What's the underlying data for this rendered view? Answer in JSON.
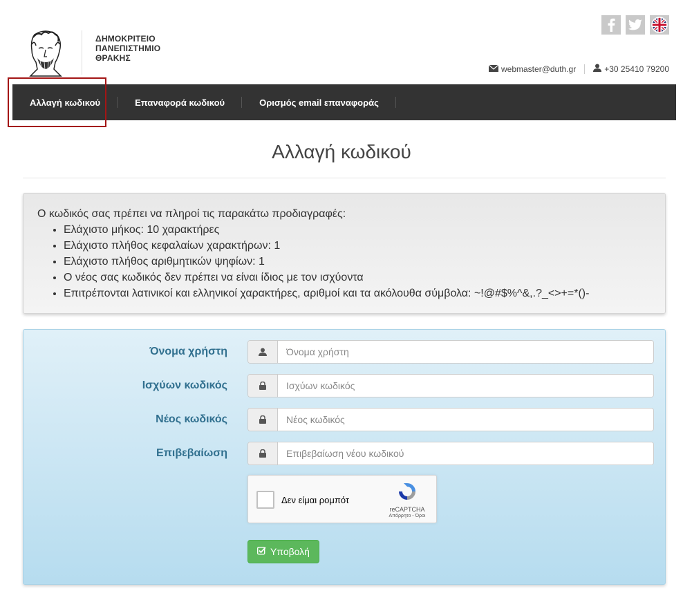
{
  "header": {
    "university_name": [
      "ΔΗΜΟΚΡΙΤΕΙΟ",
      "ΠΑΝΕΠΙΣΤΗΜΙΟ",
      "ΘΡΑΚΗΣ"
    ],
    "social_icons": [
      "facebook-icon",
      "twitter-icon",
      "english-language-icon"
    ],
    "email": "webmaster@duth.gr",
    "phone": "+30 25410 79200"
  },
  "nav": {
    "tabs": [
      {
        "label": "Αλλαγή κωδικού",
        "active": true
      },
      {
        "label": "Επαναφορά κωδικού"
      },
      {
        "label": "Ορισμός email επαναφοράς"
      }
    ]
  },
  "page": {
    "title": "Αλλαγή κωδικού"
  },
  "requirements": {
    "intro": "Ο κωδικός σας πρέπει να πληροί τις παρακάτω προδιαγραφές:",
    "items": [
      "Ελάχιστο μήκος: 10 χαρακτήρες",
      "Ελάχιστο πλήθος κεφαλαίων χαρακτήρων: 1",
      "Ελάχιστο πλήθος αριθμητικών ψηφίων: 1",
      "Ο νέος σας κωδικός δεν πρέπει να είναι ίδιος με τον ισχύοντα",
      "Επιτρέπονται λατινικοί και ελληνικοί χαρακτήρες, αριθμοί και τα ακόλουθα σύμβολα: ~!@#$%^&,.?_<>+=*()-"
    ]
  },
  "form": {
    "fields": [
      {
        "label": "Όνομα χρήστη",
        "placeholder": "Όνομα χρήστη",
        "value": "",
        "icon": "user-icon"
      },
      {
        "label": "Ισχύων κωδικός",
        "placeholder": "Ισχύων κωδικός",
        "value": "",
        "icon": "lock-icon"
      },
      {
        "label": "Νέος κωδικός",
        "placeholder": "Νέος κωδικός",
        "value": "",
        "icon": "lock-icon"
      },
      {
        "label": "Επιβεβαίωση",
        "placeholder": "Επιβεβαίωση νέου κωδικού",
        "value": "",
        "icon": "lock-icon"
      }
    ],
    "captcha": {
      "label": "Δεν είμαι ρομπότ",
      "brand": "reCAPTCHA",
      "terms": "Απόρρητο - Όροι"
    },
    "submit_label": "Υποβολή"
  },
  "colors": {
    "nav_bg": "#333333",
    "label": "#31708f",
    "submit": "#5cb85c",
    "highlight": "#a31515"
  }
}
